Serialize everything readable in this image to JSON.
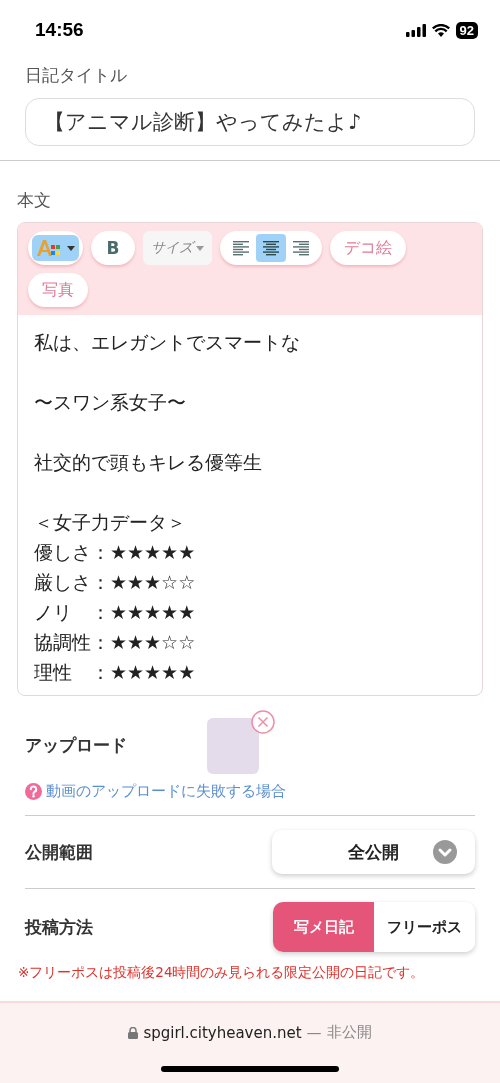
{
  "status_bar": {
    "time": "14:56",
    "battery": "92"
  },
  "title_field": {
    "label": "日記タイトル",
    "value": "【アニマル診断】やってみたよ♪"
  },
  "body_section": {
    "label": "本文",
    "toolbar": {
      "bold": "B",
      "size": "サイズ",
      "align": [
        {
          "kind": "left",
          "selected": false
        },
        {
          "kind": "center",
          "selected": true
        },
        {
          "kind": "right",
          "selected": false
        }
      ],
      "deco": "デコ絵",
      "photo": "写真"
    },
    "paragraphs": [
      [
        "私は、エレガントでスマートな"
      ],
      [
        "〜スワン系女子〜"
      ],
      [
        "社交的で頭もキレる優等生"
      ],
      [
        "＜女子力データ＞",
        "優しさ：★★★★★",
        "厳しさ：★★★☆☆",
        "ノリ　：★★★★★",
        "協調性：★★★☆☆",
        "理性　：★★★★★"
      ]
    ]
  },
  "upload": {
    "label": "アップロード",
    "help_link": "動画のアップロードに失敗する場合"
  },
  "visibility": {
    "label": "公開範囲",
    "value": "全公開"
  },
  "post_method": {
    "label": "投稿方法",
    "options": [
      {
        "label": "写メ日記",
        "selected": true
      },
      {
        "label": "フリーポス",
        "selected": false
      }
    ],
    "note": "※フリーポスは投稿後24時間のみ見られる限定公開の日記です。"
  },
  "browser_bar": {
    "domain": "spgirl.cityheaven.net",
    "separator": "—",
    "privacy": "非公開"
  }
}
